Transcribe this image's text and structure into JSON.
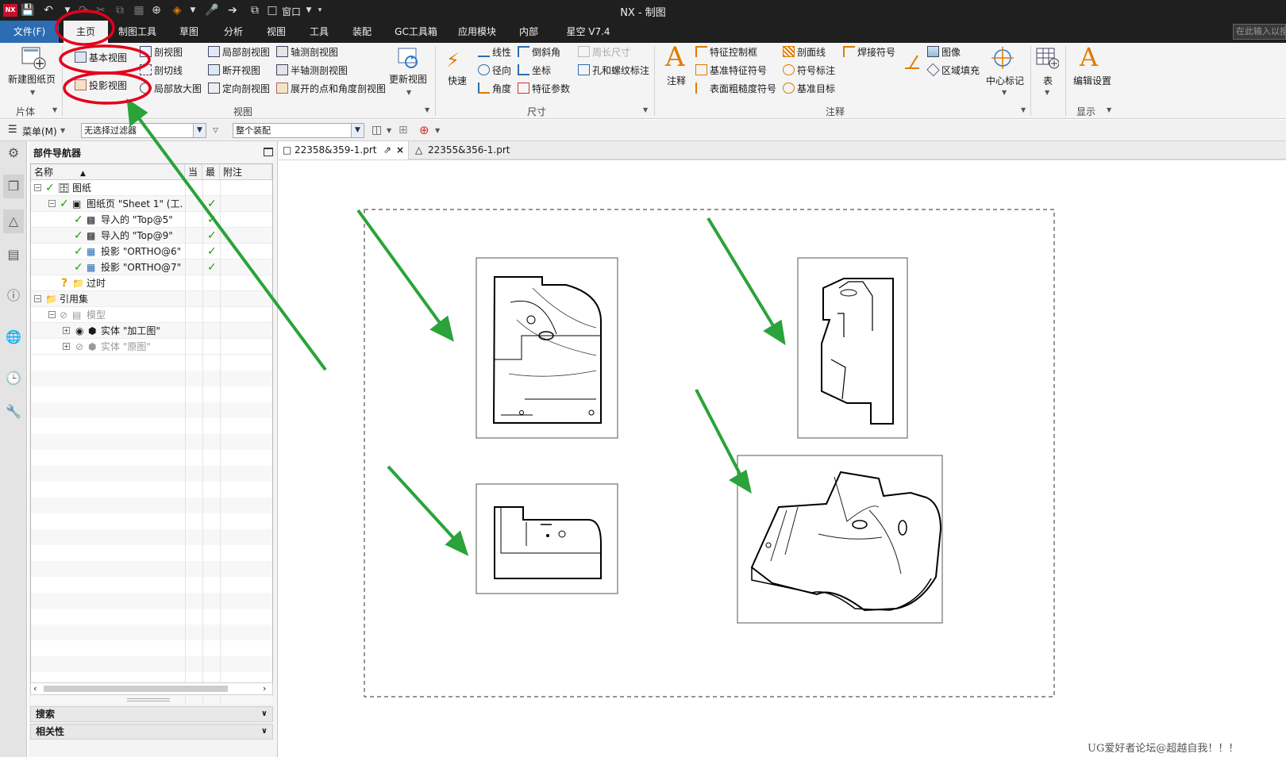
{
  "window": {
    "title": "NX - 制图",
    "logo": "NX"
  },
  "quick_access": {
    "window_label": "窗口"
  },
  "menu": {
    "tabs": [
      "文件(F)",
      "主页",
      "制图工具",
      "草图",
      "分析",
      "视图",
      "工具",
      "装配",
      "GC工具箱",
      "应用模块",
      "内部",
      "星空 V7.4"
    ],
    "search_placeholder": "在此输入以搜"
  },
  "ribbon": {
    "sheet_group": {
      "new_sheet": "新建图纸页",
      "label": "片体"
    },
    "view_group": {
      "base_view": "基本视图",
      "projected_view": "投影视图",
      "section_view": "剖视图",
      "section_line": "剖切线",
      "detail_view": "局部放大图",
      "break_out_section": "局部剖视图",
      "broken_view": "断开视图",
      "oriented_section": "定向剖视图",
      "axonometric_section": "轴测剖视图",
      "half_axo_section": "半轴测剖视图",
      "unfolded_section": "展开的点和角度剖视图",
      "update_views": "更新视图",
      "label": "视图"
    },
    "dimension_group": {
      "rapid": "快速",
      "linear": "线性",
      "radial": "径向",
      "angular": "角度",
      "chamfer": "倒斜角",
      "ordinate": "坐标",
      "feature_params": "特征参数",
      "perimeter": "周长尺寸",
      "hole_thread": "孔和螺纹标注",
      "label": "尺寸"
    },
    "annotation_group": {
      "note": "注释",
      "fcf": "特征控制框",
      "datum_feature": "基准特征符号",
      "surface_finish": "表面粗糙度符号",
      "section_line": "剖面线",
      "symbol_callout": "符号标注",
      "datum_target": "基准目标",
      "weld_symbol": "焊接符号",
      "image": "图像",
      "area_fill": "区域填充",
      "center_mark": "中心标记",
      "label": "注释"
    },
    "table_group": {
      "table": "表"
    },
    "display_group": {
      "edit_settings": "编辑设置",
      "label": "显示"
    }
  },
  "filterbar": {
    "menu": "菜单(M)",
    "filter": "无选择过滤器",
    "scope": "整个装配"
  },
  "navigator": {
    "title": "部件导航器",
    "columns": [
      "名称",
      "当",
      "最",
      "附注"
    ],
    "rows": [
      {
        "label": "图纸",
        "check": "✓",
        "latest": ""
      },
      {
        "label": "图纸页 \"Sheet 1\" (工...",
        "check": "✓",
        "latest": "✓"
      },
      {
        "label": "导入的 \"Top@5\"",
        "check": "✓",
        "latest": "✓"
      },
      {
        "label": "导入的 \"Top@9\"",
        "check": "✓",
        "latest": "✓"
      },
      {
        "label": "投影 \"ORTHO@6\"",
        "check": "✓",
        "latest": "✓"
      },
      {
        "label": "投影 \"ORTHO@7\"",
        "check": "✓",
        "latest": "✓"
      },
      {
        "label": "过时",
        "check": "?",
        "latest": ""
      },
      {
        "label": "引用集",
        "check": "",
        "latest": ""
      },
      {
        "label": "模型",
        "check": "",
        "latest": ""
      },
      {
        "label": "实体 \"加工图\"",
        "check": "",
        "latest": ""
      },
      {
        "label": "实体 \"原图\"",
        "check": "",
        "latest": ""
      }
    ],
    "search_label": "搜索",
    "related_label": "相关性"
  },
  "doc_tabs": [
    "22358&359-1.prt",
    "22355&356-1.prt"
  ],
  "watermark": "UG爱好者论坛@超越自我！！！",
  "colors": {
    "accent_file": "#2b6cb3",
    "annotation_red": "#e3001b",
    "annotation_green": "#2aa33a",
    "check_green": "#1aa000"
  }
}
